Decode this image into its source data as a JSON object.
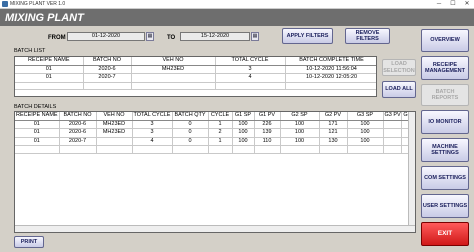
{
  "window": {
    "title": "MIXING PLANT VER 1.0",
    "minimize": "─",
    "maximize": "☐",
    "close": "✕"
  },
  "header": {
    "title": "MIXING PLANT"
  },
  "filter": {
    "from_label": "FROM",
    "from_value": "01-12-2020",
    "to_label": "TO",
    "to_value": "15-12-2020",
    "apply_label": "APPLY FILTERS",
    "remove_label": "REMOVE FILTERS",
    "calendar_glyph": "▦"
  },
  "batch_list": {
    "label": "BATCH LIST",
    "columns": [
      "RECEIPE NAME",
      "BATCH NO",
      "VEH NO",
      "TOTAL CYCLE",
      "BATCH COMPLETE TIME"
    ],
    "rows": [
      [
        "01",
        "2020-6",
        "MH23ED",
        "3",
        "10-12-2020 11:56:04"
      ],
      [
        "01",
        "2020-7",
        "",
        "4",
        "10-12-2020 12:05:20"
      ],
      [
        "",
        "",
        "",
        "",
        ""
      ]
    ],
    "load_selection_label": "LOAD SELECTION",
    "load_all_label": "LOAD ALL"
  },
  "batch_details": {
    "label": "BATCH DETAILS",
    "columns": [
      "RECEIPE NAME",
      "BATCH NO",
      "VEH NO",
      "TOTAL CYCLE",
      "BATCH QTY",
      "CYCLE",
      "G1 SP",
      "G1 PV",
      "G2 SP",
      "G2 PV",
      "G3 SP",
      "G3 PV",
      "G"
    ],
    "rows": [
      [
        "01",
        "2020-6",
        "MH23ED",
        "3",
        "0",
        "1",
        "100",
        "226",
        "100",
        "171",
        "100",
        "",
        ""
      ],
      [
        "01",
        "2020-6",
        "MH23ED",
        "3",
        "0",
        "2",
        "100",
        "139",
        "100",
        "121",
        "100",
        "",
        ""
      ],
      [
        "01",
        "2020-7",
        "",
        "4",
        "0",
        "1",
        "100",
        "110",
        "100",
        "130",
        "100",
        "",
        ""
      ],
      [
        "",
        "",
        "",
        "",
        "",
        "",
        "",
        "",
        "",
        "",
        "",
        "",
        ""
      ]
    ]
  },
  "print_label": "PRINT",
  "sidebar": {
    "overview": "OVERVIEW",
    "receipe_management": "RECEIPE MANAGEMENT",
    "batch_reports": "BATCH REPORTS",
    "io_monitor": "IO MONITOR",
    "machine_settings": "MACHINE SETTINGS",
    "com_settings": "COM SETTINGS",
    "user_settings": "USER SETTINGS",
    "exit": "EXIT"
  }
}
